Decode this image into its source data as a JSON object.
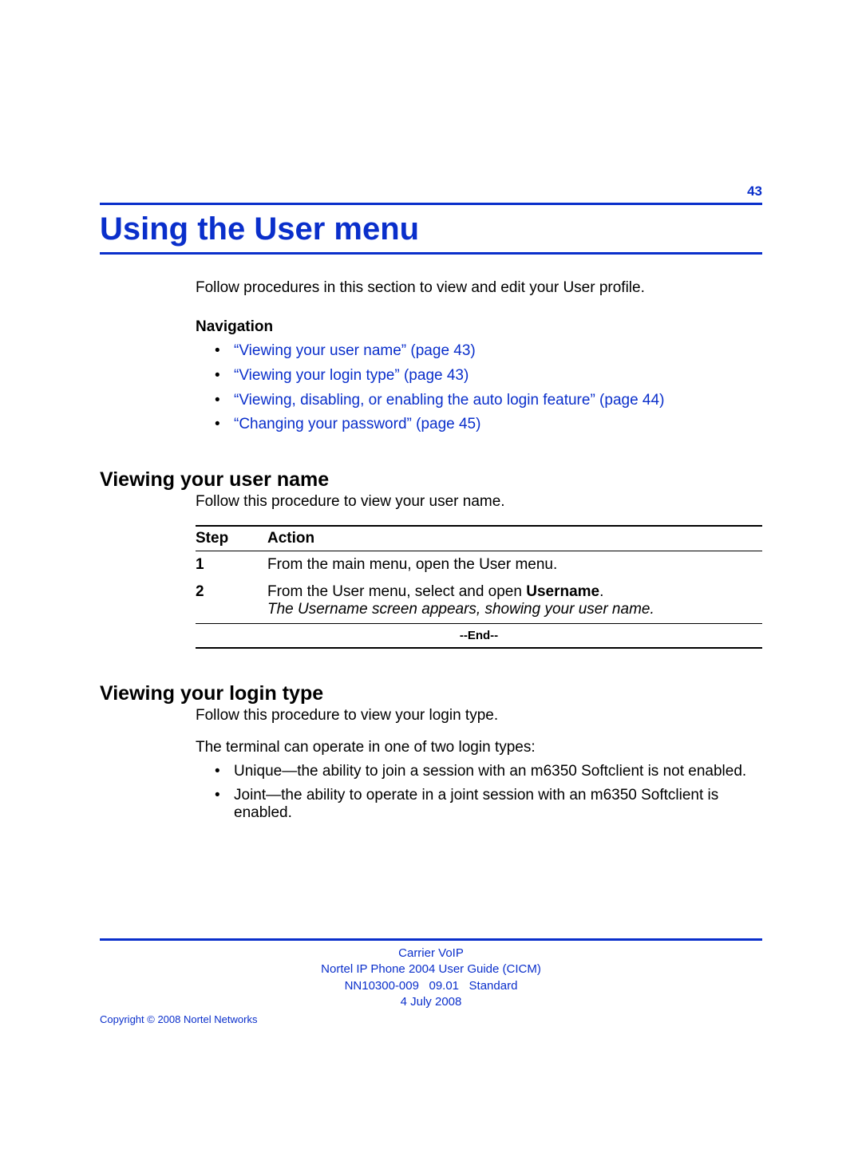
{
  "page_number": "43",
  "title": "Using the User menu",
  "intro": "Follow procedures in this section to view and edit your User profile.",
  "nav_label": "Navigation",
  "nav": [
    "“Viewing your user name” (page 43)",
    "“Viewing your login type” (page 43)",
    "“Viewing, disabling, or enabling the auto login feature” (page 44)",
    "“Changing your password” (page 45)"
  ],
  "section1": {
    "heading": "Viewing your user name",
    "intro": "Follow this procedure to view your user name.",
    "table": {
      "head_step": "Step",
      "head_action": "Action",
      "rows": [
        {
          "step": "1",
          "action": "From the main menu, open the User menu."
        },
        {
          "step": "2",
          "action_pre": "From the User menu, select and open ",
          "action_bold": "Username",
          "action_post": ".",
          "result": "The Username screen appears, showing your user name."
        }
      ],
      "end": "--End--"
    }
  },
  "section2": {
    "heading": "Viewing your login type",
    "intro": "Follow this procedure to view your login type.",
    "lead": "The terminal can operate in one of two login types:",
    "bullets": [
      "Unique—the ability to join a session with an m6350 Softclient is not enabled.",
      "Joint—the ability to operate in a joint session with an m6350 Softclient is enabled."
    ]
  },
  "footer": {
    "line1": "Carrier VoIP",
    "line2": "Nortel IP Phone 2004 User Guide (CICM)",
    "line3a": "NN10300-009",
    "line3b": "09.01",
    "line3c": "Standard",
    "line4": "4 July 2008",
    "copyright": "Copyright © 2008 Nortel Networks"
  }
}
